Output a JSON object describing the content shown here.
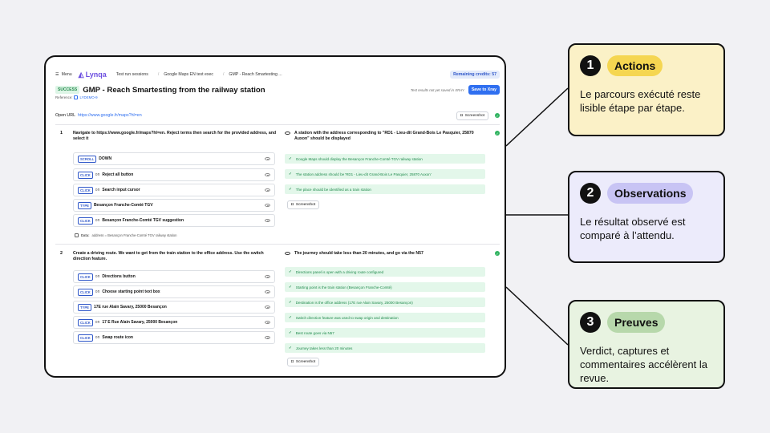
{
  "header": {
    "menu_label": "Menu",
    "logo_text": "Lynqa",
    "breadcrumbs": [
      "Test run sessions",
      "Google Maps EN test exec",
      "GMP - Reach Smartesting ..."
    ],
    "credits": "Remaining credits: 57"
  },
  "run": {
    "status": "SUCCESS",
    "title": "GMP - Reach Smartesting from the railway station",
    "reference_label": "Reference:",
    "reference_id": "LYDEMO-9",
    "not_saved": "Test results not yet saved in XRAY",
    "save_button": "Save to Xray"
  },
  "open_url": {
    "label": "Open URL",
    "url": "https://www.google.fr/maps?hl=en",
    "screenshot_label": "Screenshot"
  },
  "steps": [
    {
      "number": "1",
      "description": "Navigate to https://www.google.fr/maps?hl=en. Reject terms then search for the provided address, and select it",
      "actions": [
        {
          "type": "SCROLL",
          "on": "",
          "text": "DOWN"
        },
        {
          "type": "CLICK",
          "on": "on",
          "text": "Reject all button"
        },
        {
          "type": "CLICK",
          "on": "on",
          "text": "Search input cursor"
        },
        {
          "type": "TYPE",
          "on": "",
          "text": "Besançon Franche-Comté TGV"
        },
        {
          "type": "CLICK",
          "on": "on",
          "text": "Besançon Franche-Comté TGV suggestion"
        }
      ],
      "data_label": "Data:",
      "data_value": "address = Besançon Franche-Comté TGV railway station",
      "expected": "A station with the address corresponding to \"RD1 - Lieu-dit Grand-Bois Le Pasquier, 25870 Auxon\" should be displayed",
      "checks": [
        "Google Maps should display the Besançon Franche-Comté TGV railway station",
        "The station address should be 'RD1 - Lieu-dit Grand-Bois Le Pasquier, 25870 Auxon'",
        "The place should be identified as a train station"
      ],
      "screenshot_label": "Screenshot"
    },
    {
      "number": "2",
      "description": "Create a driving route. We want to get from the train station to the office address. Use the switch direction feature.",
      "actions": [
        {
          "type": "CLICK",
          "on": "on",
          "text": "Directions button"
        },
        {
          "type": "CLICK",
          "on": "on",
          "text": "Choose starting point text box"
        },
        {
          "type": "TYPE",
          "on": "",
          "text": "17E rue Alain Savary, 25000 Besançon"
        },
        {
          "type": "CLICK",
          "on": "on",
          "text": "17 E Rue Alain Savary, 25000 Besançon"
        },
        {
          "type": "CLICK",
          "on": "on",
          "text": "Swap route icon"
        }
      ],
      "expected": "The journey should take less than 20 minutes, and go via the N57",
      "checks": [
        "Directions panel is open with a driving route configured",
        "Starting point is the train station (Besançon Franche-Comté)",
        "Destination is the office address (17E rue Alain Savary, 25000 Besançon)",
        "Switch direction feature was used to swap origin and destination",
        "Best route goes via N57",
        "Journey takes less than 20 minutes"
      ],
      "screenshot_label": "Screenshot"
    }
  ],
  "callouts": [
    {
      "number": "1",
      "title": "Actions",
      "text": "Le parcours exécuté reste lisible étape par étape."
    },
    {
      "number": "2",
      "title": "Observations",
      "text": "Le résultat observé est comparé à l’attendu."
    },
    {
      "number": "3",
      "title": "Preuves",
      "text": "Verdict, captures et commentaires accélèrent la revue."
    }
  ]
}
